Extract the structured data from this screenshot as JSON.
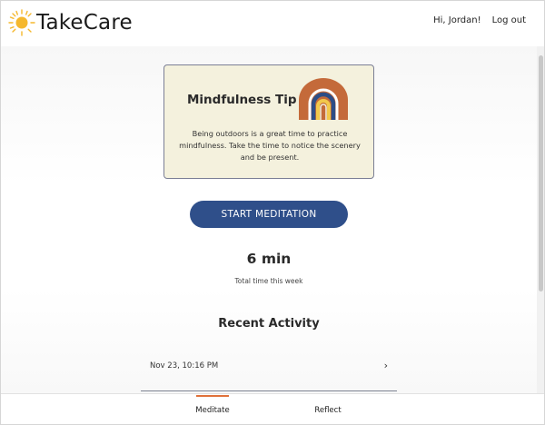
{
  "header": {
    "brand": "TakeCare",
    "greeting": "Hi, Jordan!",
    "logout_label": "Log out"
  },
  "tip": {
    "title": "Mindfulness Tip",
    "body": "Being outdoors is a great time to practice mindfulness. Take the time to notice the scenery and be present."
  },
  "start_button_label": "START MEDITATION",
  "stats": {
    "minutes": "6 min",
    "minutes_label": "Total time this week"
  },
  "recent": {
    "title": "Recent Activity",
    "items": [
      {
        "date": "Nov 23, 10:16 PM",
        "chevron": "›"
      }
    ]
  },
  "tabs": [
    {
      "label": "Meditate",
      "active": true
    },
    {
      "label": "Reflect",
      "active": false
    }
  ],
  "colors": {
    "accent": "#2f4f8a",
    "tab_indicator": "#e0713a",
    "tip_background": "#f4f1dd",
    "sun": "#f5b82e"
  },
  "icons": {
    "logo": "sun-icon",
    "tip_art": "rainbow-icon",
    "row_chevron": "chevron-right-icon"
  }
}
